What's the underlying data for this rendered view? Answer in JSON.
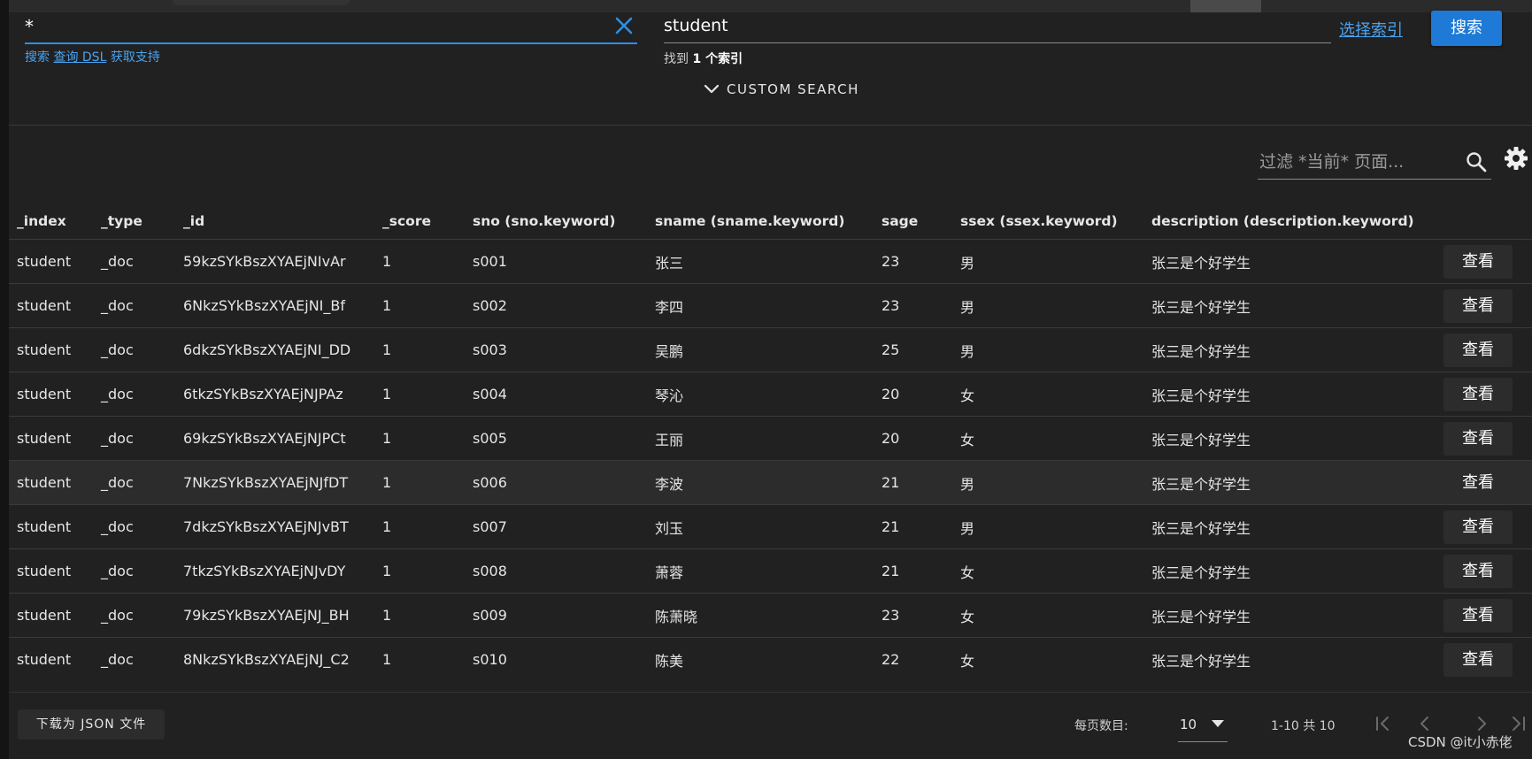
{
  "search": {
    "query_value": "*",
    "help_search": "搜索",
    "help_query_dsl": "查询 DSL",
    "help_support": "获取支持",
    "index_value": "student",
    "found_prefix": "找到",
    "found_count": "1 个索引",
    "choose_index_label": "选择索引",
    "search_button_label": "搜索",
    "custom_search_label": "CUSTOM SEARCH"
  },
  "filter": {
    "placeholder": "过滤 *当前* 页面..."
  },
  "table": {
    "columns": [
      "_index",
      "_type",
      "_id",
      "_score",
      "sno (sno.keyword)",
      "sname (sname.keyword)",
      "sage",
      "ssex (ssex.keyword)",
      "description (description.keyword)"
    ],
    "view_label": "查看",
    "rows": [
      [
        "student",
        "_doc",
        "59kzSYkBszXYAEjNIvAr",
        "1",
        "s001",
        "张三",
        "23",
        "男",
        "张三是个好学生"
      ],
      [
        "student",
        "_doc",
        "6NkzSYkBszXYAEjNI_Bf",
        "1",
        "s002",
        "李四",
        "23",
        "男",
        "张三是个好学生"
      ],
      [
        "student",
        "_doc",
        "6dkzSYkBszXYAEjNI_DD",
        "1",
        "s003",
        "吴鹏",
        "25",
        "男",
        "张三是个好学生"
      ],
      [
        "student",
        "_doc",
        "6tkzSYkBszXYAEjNJPAz",
        "1",
        "s004",
        "琴沁",
        "20",
        "女",
        "张三是个好学生"
      ],
      [
        "student",
        "_doc",
        "69kzSYkBszXYAEjNJPCt",
        "1",
        "s005",
        "王丽",
        "20",
        "女",
        "张三是个好学生"
      ],
      [
        "student",
        "_doc",
        "7NkzSYkBszXYAEjNJfDT",
        "1",
        "s006",
        "李波",
        "21",
        "男",
        "张三是个好学生"
      ],
      [
        "student",
        "_doc",
        "7dkzSYkBszXYAEjNJvBT",
        "1",
        "s007",
        "刘玉",
        "21",
        "男",
        "张三是个好学生"
      ],
      [
        "student",
        "_doc",
        "7tkzSYkBszXYAEjNJvDY",
        "1",
        "s008",
        "萧蓉",
        "21",
        "女",
        "张三是个好学生"
      ],
      [
        "student",
        "_doc",
        "79kzSYkBszXYAEjNJ_BH",
        "1",
        "s009",
        "陈萧晓",
        "23",
        "女",
        "张三是个好学生"
      ],
      [
        "student",
        "_doc",
        "8NkzSYkBszXYAEjNJ_C2",
        "1",
        "s010",
        "陈美",
        "22",
        "女",
        "张三是个好学生"
      ]
    ]
  },
  "footer": {
    "download_label": "下载为 JSON 文件",
    "rows_per_page_label": "每页数目:",
    "rows_per_page_value": "10",
    "range_text": "1-10 共 10",
    "watermark": "CSDN @it小赤佬"
  },
  "colors": {
    "accent": "#1e7ad6",
    "link": "#4aa3f0",
    "background": "#212121"
  }
}
